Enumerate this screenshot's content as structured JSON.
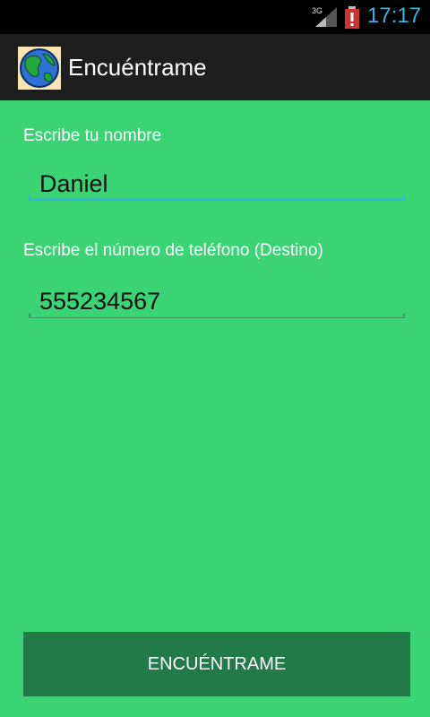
{
  "status_bar": {
    "network_type": "3G",
    "time": "17:17",
    "icons": [
      "signal-icon",
      "battery-alert-icon"
    ]
  },
  "action_bar": {
    "title": "Encuéntrame",
    "icon": "globe-icon"
  },
  "form": {
    "name_label": "Escribe tu nombre",
    "name_value": "Daniel",
    "phone_label": "Escribe el número de teléfono (Destino)",
    "phone_value": "555234567"
  },
  "button": {
    "label": "ENCUÉNTRAME"
  },
  "colors": {
    "background": "#3bd474",
    "button": "#227a48",
    "accent": "#33b5e5",
    "action_bar": "#1e1e1e"
  }
}
